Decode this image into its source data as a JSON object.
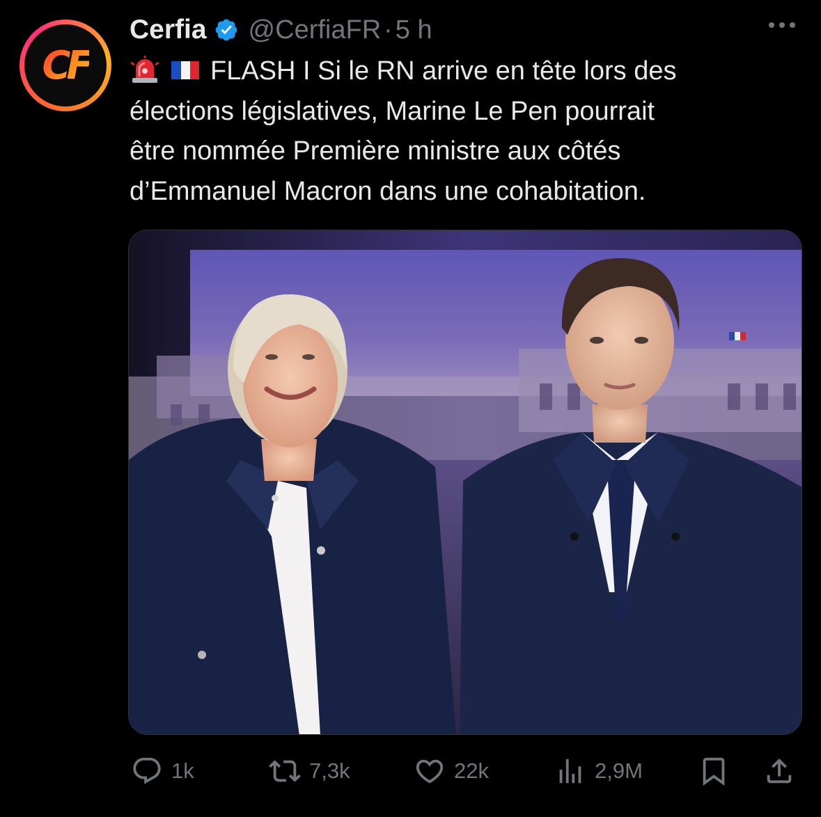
{
  "tweet": {
    "display_name": "Cerfia",
    "handle": "@CerfiaFR",
    "separator": "·",
    "time": "5 h",
    "avatar_text": "CF",
    "text_lines": [
      "FLASH I Si le RN arrive en tête lors des",
      "élections législatives, Marine Le Pen pourrait",
      "être nommée Première ministre aux côtés",
      "d’Emmanuel Macron dans une cohabitation."
    ],
    "emojis": [
      "rotating-light-icon",
      "france-flag-icon"
    ]
  },
  "actions": {
    "replies": "1k",
    "reposts": "7,3k",
    "likes": "22k",
    "views": "2,9M"
  },
  "colors": {
    "background": "#000000",
    "text_primary": "#e7e9ea",
    "text_secondary": "#71767b",
    "verified": "#1d9bf0"
  }
}
